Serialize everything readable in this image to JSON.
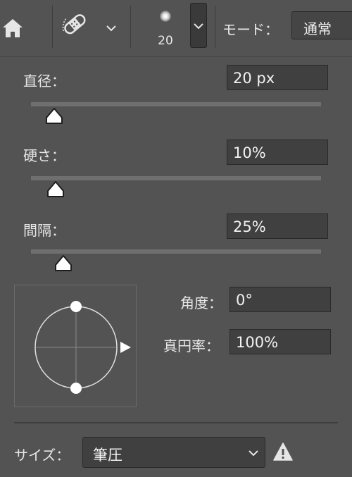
{
  "options_bar": {
    "home_icon": "home-icon",
    "tool_icon": "healing-brush-icon",
    "tool_dropdown_icon": "chevron-down-icon",
    "brush_size": "20",
    "mode_label": "モード：",
    "mode_value": "通常"
  },
  "brush_panel": {
    "diameter": {
      "label": "直径：",
      "value": "20 px",
      "slider_fraction": 0.07
    },
    "hardness": {
      "label": "硬さ：",
      "value": "10%",
      "slider_fraction": 0.08
    },
    "spacing": {
      "label": "間隔：",
      "value": "25%",
      "slider_fraction": 0.11
    },
    "angle": {
      "label": "角度：",
      "value": "0°"
    },
    "roundness": {
      "label": "真円率：",
      "value": "100%"
    },
    "size_control": {
      "label": "サイズ：",
      "value": "筆圧",
      "warning_icon": "warning-icon"
    }
  },
  "colors": {
    "panel_bg": "#535353",
    "input_bg": "#404040",
    "track": "#6f6f6f"
  }
}
